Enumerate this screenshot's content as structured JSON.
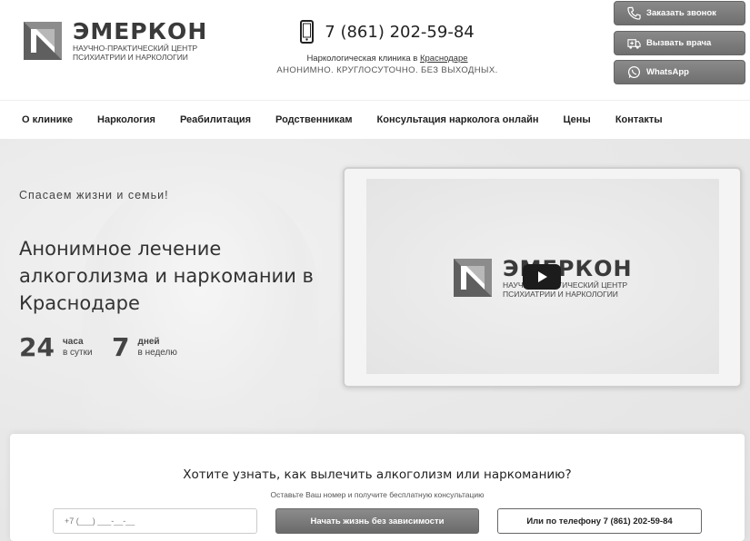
{
  "header": {
    "logo_name": "ЭМЕРКОН",
    "logo_sub_line1": "НАУЧНО-ПРАКТИЧЕСКИЙ ЦЕНТР",
    "logo_sub_line2": "ПСИХИАТРИИ И НАРКОЛОГИИ",
    "phone": "7 (861) 202-59-84",
    "clinic_prefix": "Наркологическая клиника в",
    "clinic_city_link": "Краснодаре",
    "clinic_hours": "АНОНИМНО. КРУГЛОСУТОЧНО. БЕЗ ВЫХОДНЫХ.",
    "buttons": {
      "callback": "Заказать звонок",
      "doctor": "Вызвать врача",
      "whatsapp": "WhatsApp"
    }
  },
  "nav": {
    "items": [
      "О клинике",
      "Наркология",
      "Реабилитация",
      "Родственникам",
      "Консультация нарколога онлайн",
      "Цены",
      "Контакты"
    ]
  },
  "hero": {
    "tagline": "Спасаем жизни и семьи!",
    "headline": "Анонимное лечение алкоголизма и наркомании в Краснодаре",
    "stats": [
      {
        "num": "24",
        "top": "часа",
        "bottom": "в сутки"
      },
      {
        "num": "7",
        "top": "дней",
        "bottom": "в неделю"
      }
    ],
    "video": {
      "logo_name": "ЭМЕРКОН",
      "logo_sub_line1": "НАУЧНО-ПРАКТИЧЕСКИЙ ЦЕНТР",
      "logo_sub_line2": "ПСИХИАТРИИ И НАРКОЛОГИИ"
    }
  },
  "form": {
    "title": "Хотите узнать, как вылечить алкоголизм или наркоманию?",
    "subtitle": "Оставьте Ваш номер и получите бесплатную консультацию",
    "phone_placeholder": "+7 (___) ___-__-__",
    "submit_label": "Начать жизнь без зависимости",
    "call_label": "Или по телефону 7 (861) 202-59-84"
  },
  "colors": {
    "button_gray": "#7a7a7a",
    "text_dark": "#222222",
    "hero_bg": "#e8e8e8"
  }
}
